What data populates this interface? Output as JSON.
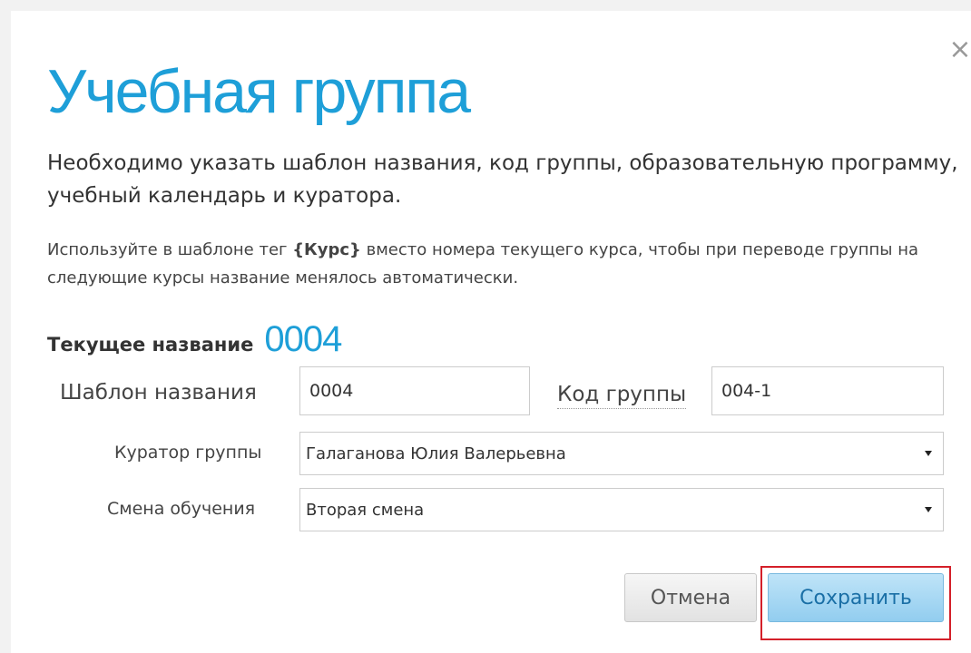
{
  "dialog": {
    "title": "Учебная группа",
    "close_glyph": "×",
    "intro": "Необходимо указать шаблон названия, код группы, образовательную программу, учебный календарь и куратора.",
    "hint_before": "Используйте в шаблоне тег ",
    "hint_tag": "{Курс}",
    "hint_after": " вместо номера текущего курса, чтобы при переводе группы на следующие курсы название менялось автоматически.",
    "current_name_label": "Текущее название",
    "current_name_value": "0004"
  },
  "form": {
    "name_template_label": "Шаблон названия",
    "name_template_value": "0004",
    "group_code_label": "Код группы",
    "group_code_value": "004-1",
    "curator_label": "Куратор группы",
    "curator_value": "Галаганова Юлия Валерьевна",
    "shift_label": "Смена обучения",
    "shift_value": "Вторая смена"
  },
  "buttons": {
    "cancel": "Отмена",
    "save": "Сохранить"
  },
  "colors": {
    "accent": "#1e9fd8",
    "highlight": "#d4202a"
  },
  "icons": {
    "close": "close-icon",
    "dropdown": "chevron-down-icon"
  }
}
